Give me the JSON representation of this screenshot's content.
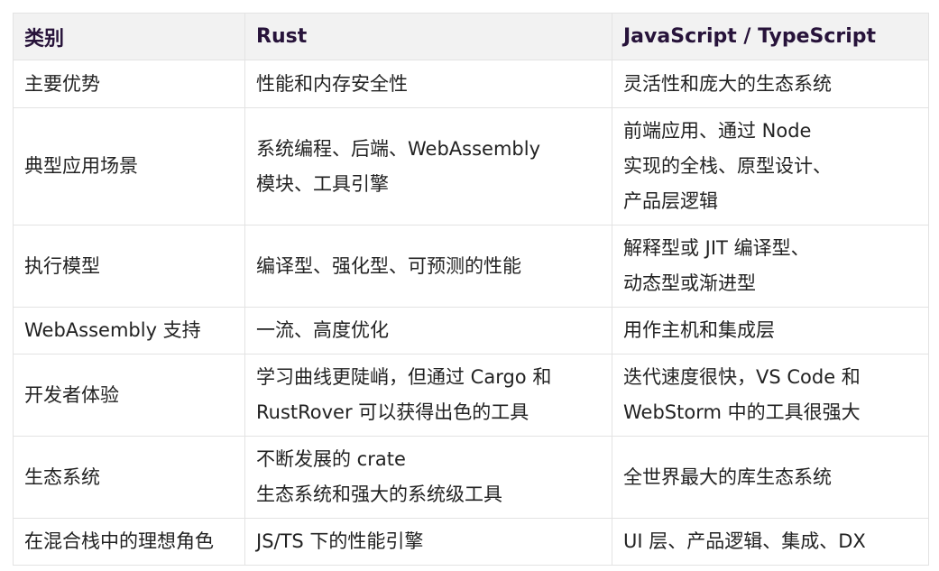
{
  "table": {
    "headers": [
      "类别",
      "Rust",
      "JavaScript / TypeScript"
    ],
    "rows": [
      {
        "category": "主要优势",
        "rust": [
          "性能和内存安全性"
        ],
        "js": [
          "灵活性和庞大的生态系统"
        ]
      },
      {
        "category": "典型应用场景",
        "rust": [
          "系统编程、后端、WebAssembly",
          "模块、工具引擎"
        ],
        "js": [
          "前端应用、通过 Node",
          "实现的全栈、原型设计、",
          "产品层逻辑"
        ]
      },
      {
        "category": "执行模型",
        "rust": [
          "编译型、强化型、可预测的性能"
        ],
        "js": [
          "解释型或 JIT 编译型、",
          "动态型或渐进型"
        ]
      },
      {
        "category": "WebAssembly 支持",
        "rust": [
          "一流、高度优化"
        ],
        "js": [
          "用作主机和集成层"
        ]
      },
      {
        "category": "开发者体验",
        "rust": [
          "学习曲线更陡峭，但通过 Cargo 和",
          "RustRover 可以获得出色的工具"
        ],
        "js": [
          "迭代速度很快，VS Code 和",
          "WebStorm 中的工具很强大"
        ]
      },
      {
        "category": "生态系统",
        "rust": [
          "不断发展的 crate",
          "生态系统和强大的系统级工具"
        ],
        "js": [
          "全世界最大的库生态系统"
        ]
      },
      {
        "category": "在混合栈中的理想角色",
        "rust": [
          "JS/TS 下的性能引擎"
        ],
        "js": [
          "UI 层、产品逻辑、集成、DX"
        ]
      }
    ]
  }
}
